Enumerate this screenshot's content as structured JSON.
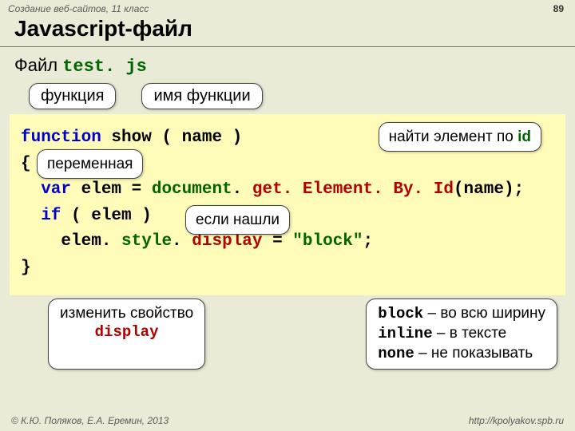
{
  "header": {
    "course": "Создание веб-сайтов, 11 класс",
    "pagenum": "89"
  },
  "title": "Javascript-файл",
  "subtitle_plain": "Файл ",
  "subtitle_code": "test. js",
  "labels": {
    "func_kw": "функция",
    "func_name": "имя функции",
    "find_elem_prefix": "найти элемент по ",
    "find_elem_code": "id",
    "variable": "переменная",
    "if_found": "если нашли",
    "change_prop_line1": "изменить свойство",
    "change_prop_line2": "display",
    "block_code": "block",
    "block_txt": " – во всю ширину",
    "inline_code": "inline",
    "inline_txt": " – в тексте",
    "none_code": "none",
    "none_txt": " – не показывать"
  },
  "code": {
    "l1_a": "function",
    "l1_b": " show ( name )",
    "l2": "{",
    "l3_a": "  var",
    "l3_b": " elem = ",
    "l3_c": "document",
    "l3_d": ". ",
    "l3_e": "get. Element. By. Id",
    "l3_f": "(name);",
    "l4_a": "  if",
    "l4_b": " ( elem )",
    "l5_a": "    elem. ",
    "l5_b": "style",
    "l5_c": ". ",
    "l5_d": "display",
    "l5_e": " = ",
    "l5_f": "\"block\"",
    "l5_g": ";",
    "l6": "}"
  },
  "footer": {
    "left": "© К.Ю. Поляков, Е.А. Еремин, 2013",
    "right": "http://kpolyakov.spb.ru"
  }
}
